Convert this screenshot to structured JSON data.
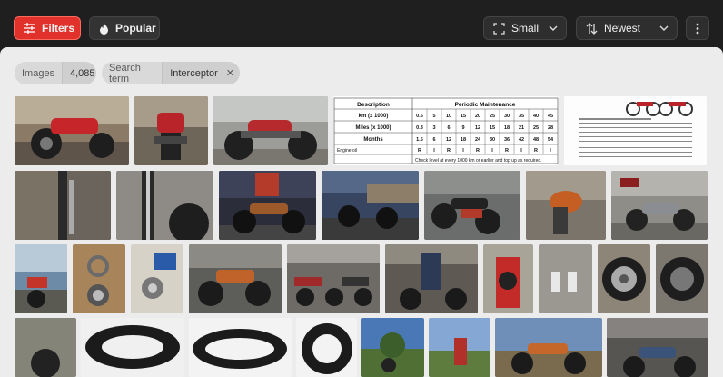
{
  "toolbar": {
    "filters_label": "Filters",
    "popular_label": "Popular",
    "size_label": "Small",
    "sort_label": "Newest"
  },
  "chips": {
    "images_label": "Images",
    "images_count": "4,085",
    "search_term_label": "Search term",
    "search_term_value": "Interceptor"
  },
  "table_doc": {
    "col_description": "Description",
    "col_periodic": "Periodic Maintenance",
    "row_km": "km (x 1000)",
    "row_miles": "Miles (x 1000)",
    "row_months": "Months",
    "row_engine_oil": "Engine oil",
    "km_values": [
      "0.5",
      "5",
      "10",
      "15",
      "20",
      "25",
      "30",
      "35",
      "40",
      "45"
    ],
    "miles_values": [
      "0.3",
      "3",
      "6",
      "9",
      "12",
      "15",
      "18",
      "21",
      "25",
      "28"
    ],
    "month_values": [
      "1.5",
      "6",
      "12",
      "18",
      "24",
      "30",
      "36",
      "42",
      "48",
      "54"
    ],
    "oil_values": [
      "R",
      "I",
      "R",
      "I",
      "R",
      "I",
      "R",
      "I",
      "R",
      "I"
    ],
    "note": "Check level at every 1000 km or earlier and top up as required."
  },
  "colors": {
    "accent": "#e0312b",
    "toolbar_bg": "#1f1f1f",
    "content_bg": "#ececec"
  },
  "icons": [
    "sliders-icon",
    "flame-icon",
    "expand-icon",
    "sort-icon",
    "chevron-down-icon",
    "more-vertical-icon",
    "close-icon"
  ]
}
